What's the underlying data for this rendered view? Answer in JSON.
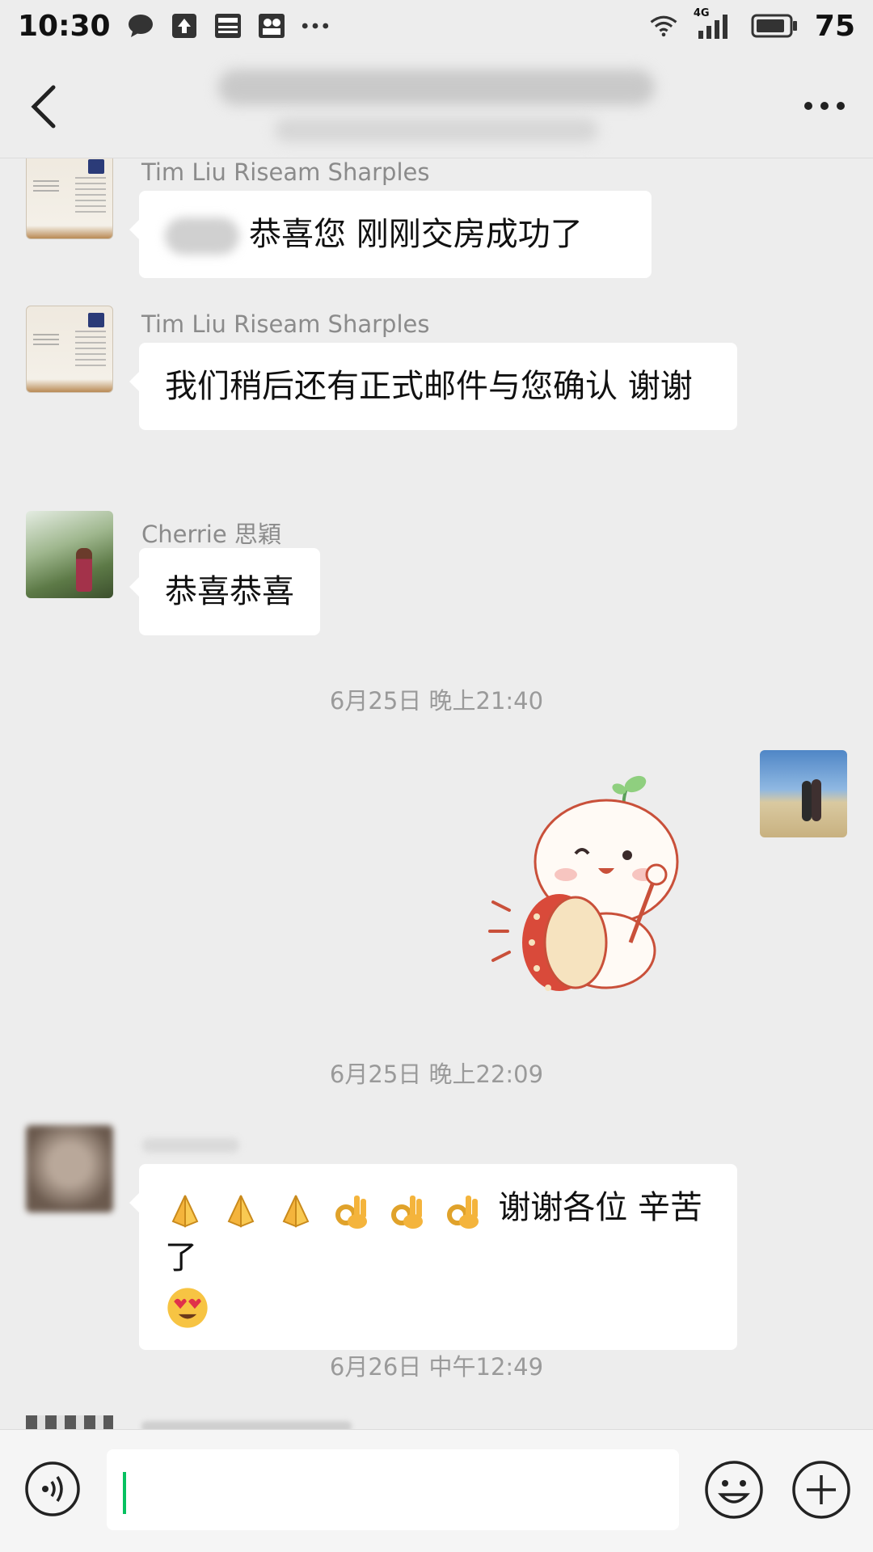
{
  "status_bar": {
    "time": "10:30",
    "network": "4G",
    "battery": "75",
    "icons": [
      "chat-bubble-icon",
      "upload-icon",
      "news-icon",
      "media-icon",
      "more-dots-icon",
      "wifi-icon",
      "signal-icon",
      "battery-icon"
    ]
  },
  "header": {
    "back_icon": "chevron-left-icon",
    "more_icon": "more-horizontal-icon"
  },
  "messages": [
    {
      "sender": "Tim Liu Riseam Sharples",
      "text": "恭喜您 刚刚交房成功了"
    },
    {
      "sender": "Tim Liu Riseam Sharples",
      "text": "我们稍后还有正式邮件与您确认 谢谢"
    },
    {
      "sender": "Cherrie 思穎",
      "text": "恭喜恭喜"
    },
    {
      "timestamp": "6月25日 晚上21:40"
    },
    {
      "sticker": "drum-bunny-sticker"
    },
    {
      "timestamp": "6月25日 晚上22:09"
    },
    {
      "text": "谢谢各位 辛苦了"
    },
    {
      "timestamp": "6月26日 中午12:49"
    }
  ],
  "input_bar": {
    "voice_icon": "voice-icon",
    "emoji_icon": "emoji-icon",
    "plus_icon": "plus-circle-icon",
    "value": ""
  },
  "colors": {
    "background": "#ededed",
    "bubble": "#ffffff",
    "accent": "#07c160"
  }
}
